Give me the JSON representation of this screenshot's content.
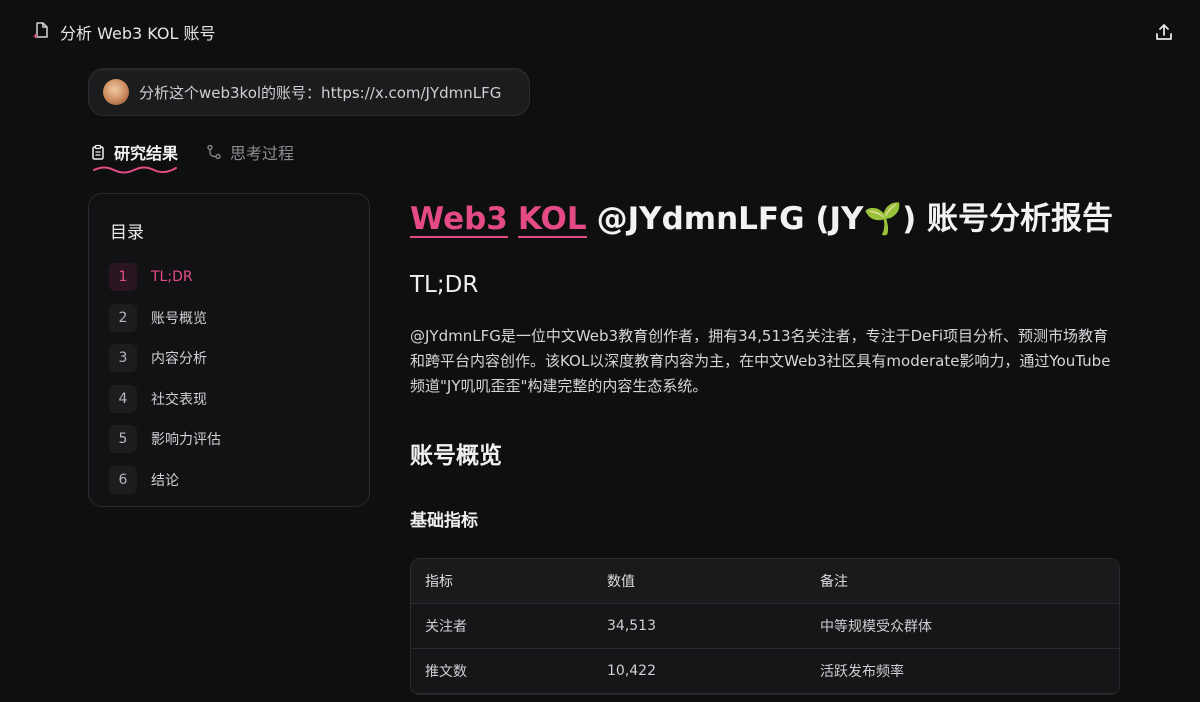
{
  "window": {
    "title": "分析 Web3 KOL 账号",
    "share_icon": "share-upload-icon"
  },
  "query": {
    "text": "分析这个web3kol的账号：https://x.com/JYdmnLFG"
  },
  "tabs": [
    {
      "label": "研究结果",
      "icon": "clipboard-icon",
      "active": true
    },
    {
      "label": "思考过程",
      "icon": "branch-icon",
      "active": false
    }
  ],
  "toc": {
    "title": "目录",
    "items": [
      {
        "num": "1",
        "label": "TL;DR",
        "active": true
      },
      {
        "num": "2",
        "label": "账号概览"
      },
      {
        "num": "3",
        "label": "内容分析"
      },
      {
        "num": "4",
        "label": "社交表现"
      },
      {
        "num": "5",
        "label": "影响力评估"
      },
      {
        "num": "6",
        "label": "结论"
      }
    ]
  },
  "report": {
    "title_hl1": "Web3",
    "title_hl2": "KOL",
    "title_rest": "@JYdmnLFG (JY🌱) 账号分析报告",
    "tldr_heading": "TL;DR",
    "tldr_text": "@JYdmnLFG是一位中文Web3教育创作者，拥有34,513名关注者，专注于DeFi项目分析、预测市场教育和跨平台内容创作。该KOL以深度教育内容为主，在中文Web3社区具有moderate影响力，通过YouTube频道\"JY叽叽歪歪\"构建完整的内容生态系统。",
    "overview_heading": "账号概览",
    "metrics_heading": "基础指标",
    "table": {
      "headers": [
        "指标",
        "数值",
        "备注"
      ],
      "rows": [
        [
          "关注者",
          "34,513",
          "中等规模受众群体"
        ],
        [
          "推文数",
          "10,422",
          "活跃发布频率"
        ]
      ]
    }
  },
  "colors": {
    "accent": "#e44b86",
    "background": "#0f0f10"
  }
}
